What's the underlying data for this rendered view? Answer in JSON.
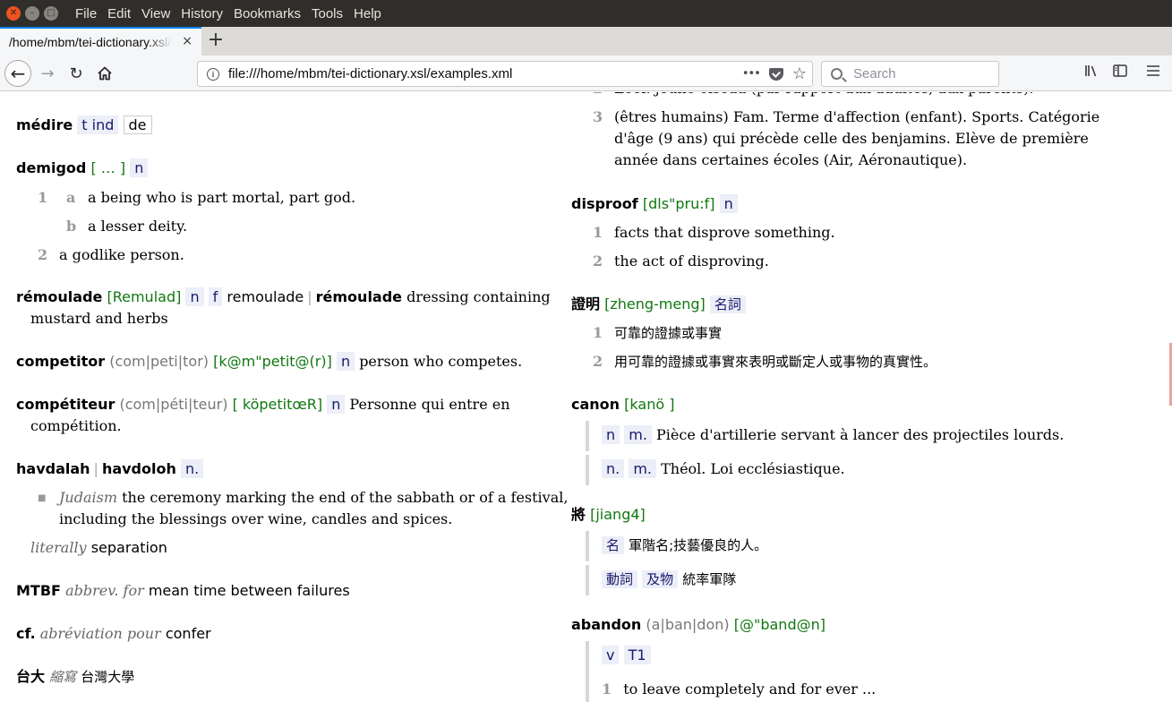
{
  "window": {
    "menu": [
      "File",
      "Edit",
      "View",
      "History",
      "Bookmarks",
      "Tools",
      "Help"
    ]
  },
  "tab": {
    "title": "/home/mbm/tei-dictionary.xsl/examples.xml",
    "close": "×",
    "new_tab": "+"
  },
  "navbar": {
    "url": "file:///home/mbm/tei-dictionary.xsl/examples.xml",
    "search_placeholder": "Search",
    "page_actions": "•••"
  },
  "left": {
    "medire": {
      "hw": "médire",
      "pos": "t ind",
      "prep": "de"
    },
    "demigod": {
      "hw": "demigod",
      "pron": "[ … ]",
      "pos": "n",
      "s1": "1",
      "s1a": "a",
      "s1a_text": "a being who is part mortal, part god.",
      "s1b": "b",
      "s1b_text": "a lesser deity.",
      "s2": "2",
      "s2_text": "a godlike person."
    },
    "remoulade": {
      "hw": "rémoulade",
      "pron": "[Remulad]",
      "pos1": "n",
      "pos2": "f",
      "v1": "remoulade",
      "sep": "|",
      "v2": "rémoulade",
      "def1": "dressing containing",
      "def2": "mustard and herbs"
    },
    "competitor": {
      "hw": "competitor",
      "syll": "(com|peti|tor)",
      "pron": "[k@m\"petit@(r)]",
      "pos": "n",
      "def": "person who competes."
    },
    "competiteur": {
      "hw": "compétiteur",
      "syll": "(com|péti|teur)",
      "pron": "[ köpetitœR]",
      "pos": "n",
      "def1": "Personne qui entre en",
      "def2": "compétition."
    },
    "havdalah": {
      "hw": "havdalah",
      "sep": "|",
      "hw2": "havdoloh",
      "pos": "n.",
      "bullet": "■",
      "label": "Judaism",
      "def1": "the ceremony marking the end of the sabbath or of a festival,",
      "def2": "including the blessings over wine, candles and spices.",
      "lit_label": "literally",
      "lit": "separation"
    },
    "mtbf": {
      "hw": "MTBF",
      "label": "abbrev. for",
      "exp": "mean time between failures"
    },
    "cf": {
      "hw": "cf.",
      "label": "abréviation pour",
      "exp": "confer"
    },
    "taida": {
      "hw": "台大",
      "label": "縮寫",
      "exp": "台灣大學"
    }
  },
  "right": {
    "partial": {
      "n2_line": "Zool. jeune oiseau (par rapport aux adultes, aux parents).",
      "n3": "3",
      "n3_l1": "(êtres humains) Fam. Terme d'affection (enfant). Sports. Catégorie",
      "n3_l2": "d'âge (9 ans) qui précède celle des benjamins. Elève de première",
      "n3_l3": "année dans certaines écoles (Air, Aéronautique)."
    },
    "disproof": {
      "hw": "disproof",
      "pron": "[dls\"pru:f]",
      "pos": "n",
      "s1": "1",
      "s1_text": "facts that disprove something.",
      "s2": "2",
      "s2_text": "the act of disproving."
    },
    "zhengming": {
      "hw": "證明",
      "pron": "[zheng-meng]",
      "pos": "名詞",
      "s1": "1",
      "s1_text": "可靠的證據或事實",
      "s2": "2",
      "s2_text": "用可靠的證據或事實來表明或斷定人或事物的真實性。"
    },
    "canon": {
      "hw": "canon",
      "pron": "[kanö ]",
      "b1_pos1": "n",
      "b1_pos2": "m.",
      "b1_text": "Pièce d'artillerie servant à lancer des projectiles lourds.",
      "b2_pos1": "n.",
      "b2_pos2": "m.",
      "b2_text": "Théol. Loi ecclésiastique."
    },
    "jiang": {
      "hw": "將",
      "pron": "[jiang4]",
      "b1_pos": "名",
      "b1_text": "軍階名;技藝優良的人。",
      "b2_pos1": "動詞",
      "b2_pos2": "及物",
      "b2_text": "統率軍隊"
    },
    "abandon": {
      "hw": "abandon",
      "syll": "(a|ban|don)",
      "pron": "[@\"band@n]",
      "pos1": "v",
      "pos2": "T1",
      "s1": "1",
      "s1_text": "to leave completely and for ever ..."
    }
  }
}
